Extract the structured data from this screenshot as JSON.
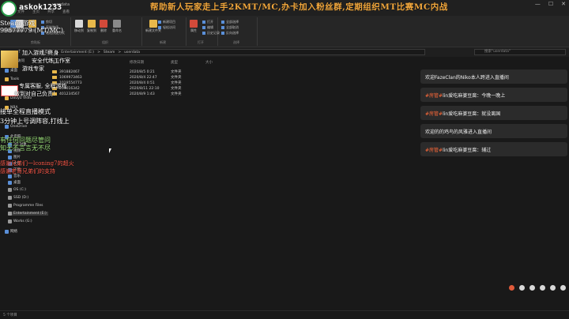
{
  "window": {
    "title": "userdata",
    "tabs": [
      "文件",
      "主页",
      "共享",
      "查看"
    ],
    "minimize_glyph": "—",
    "maximize_glyph": "☐",
    "close_glyph": "✕"
  },
  "ribbon": {
    "groups": [
      {
        "label": "剪贴板",
        "buttons": [
          "固定到快速访问",
          "复制",
          "粘贴"
        ],
        "small": [
          "剪切",
          "复制路径",
          "粘贴快捷方式"
        ]
      },
      {
        "label": "组织",
        "buttons": [
          "移动到",
          "复制到",
          "删除",
          "重命名"
        ]
      },
      {
        "label": "新建",
        "buttons": [
          "新建文件夹"
        ],
        "small": [
          "新建项目",
          "轻松访问"
        ]
      },
      {
        "label": "打开",
        "buttons": [
          "属性"
        ],
        "small": [
          "打开",
          "编辑",
          "历史记录"
        ]
      },
      {
        "label": "选择",
        "small": [
          "全部选择",
          "全部取消",
          "反向选择"
        ]
      }
    ]
  },
  "address": {
    "nav": [
      "←",
      "→",
      "↑"
    ],
    "crumbs": [
      "此电脑",
      "Entertainment (E:)",
      "Steam",
      "userdata"
    ],
    "separator": ">",
    "search_placeholder": "搜索\"userdata\""
  },
  "sidebar": {
    "items": [
      {
        "label": "快速访问",
        "color": "#5a8fd8"
      },
      {
        "label": "桌面",
        "color": "#5a8fd8"
      },
      {
        "label": "Tools",
        "color": "#e8b84a"
      },
      {
        "label": "下载",
        "color": "#5a8fd8"
      },
      {
        "label": "Douyu Vidio",
        "color": "#e8b84a"
      },
      {
        "label": "NBA",
        "color": "#e8b84a"
      },
      {
        "label": "OneDrive",
        "color": "#5a8fd8"
      },
      {
        "label": "此电脑",
        "color": "#5a8fd8"
      },
      {
        "label": "3D 对象",
        "color": "#5a8fd8"
      },
      {
        "label": "视频",
        "color": "#5a8fd8"
      },
      {
        "label": "图片",
        "color": "#5a8fd8"
      },
      {
        "label": "文档",
        "color": "#5a8fd8"
      },
      {
        "label": "下载",
        "color": "#5a8fd8"
      },
      {
        "label": "音乐",
        "color": "#5a8fd8"
      },
      {
        "label": "桌面",
        "color": "#5a8fd8"
      },
      {
        "label": "OS (C:)",
        "color": "#999999"
      },
      {
        "label": "SSD (D:)",
        "color": "#999999"
      },
      {
        "label": "Programme Files",
        "color": "#999999"
      },
      {
        "label": "Entertainment (E:)",
        "color": "#999999",
        "active": true
      },
      {
        "label": "Works (G:)",
        "color": "#999999"
      },
      {
        "label": "网络",
        "color": "#5a8fd8"
      }
    ]
  },
  "list": {
    "headers": [
      "名称",
      "修改日期",
      "类型",
      "大小"
    ],
    "rows": [
      {
        "name": "391882467",
        "date": "2020/8/5 0:21",
        "type": "文件夹"
      },
      {
        "name": "1069973463",
        "date": "2020/8/4 22:47",
        "type": "文件夹"
      },
      {
        "name": "1019554773",
        "date": "2020/8/4 0:51",
        "type": "文件夹"
      },
      {
        "name": "201016342",
        "date": "2020/8/11 22:10",
        "type": "文件夹"
      },
      {
        "name": "401234567",
        "date": "2020/8/9 1:43",
        "type": "文件夹"
      }
    ]
  },
  "status": {
    "text": "5 个项目"
  },
  "overlay": {
    "banner": "帮助新人玩家走上手2KMT/MC,办卡加入粉丝群,定期组织MT比赛MC内战",
    "handle": "askok1233",
    "lines": [
      {
        "text": "Steam 游戏",
        "cls": "ov-white",
        "size": 8
      },
      {
        "text": "99877779 (MT/MC)",
        "cls": "ov-white",
        "size": 8
      },
      {
        "text": "加入游戏, 终身",
        "cls": "ov-white",
        "size": 7
      },
      {
        "text": "安全代练工作室",
        "cls": "ov-white",
        "size": 7
      },
      {
        "text": "游戏专家",
        "cls": "ov-white",
        "size": 7
      },
      {
        "text": "专属客服, 全程游戏",
        "cls": "ov-white",
        "size": 7
      },
      {
        "text": "做到对自己负责!",
        "cls": "ov-white",
        "size": 7
      },
      {
        "text": "接单全程直播模式",
        "cls": "ov-white",
        "size": 8
      },
      {
        "text": "3分钟上号调阵容,打线上",
        "cls": "ov-white",
        "size": 8
      },
      {
        "text": "有任何问题尽管问",
        "cls": "ov-green",
        "size": 8
      },
      {
        "text": "知无不言言无不尽",
        "cls": "ov-green",
        "size": 8
      },
      {
        "text": "感谢兄弟们一lconing7的超火",
        "cls": "ov-red",
        "size": 7
      },
      {
        "text": "感谢老哥兄弟们的支持",
        "cls": "ov-red",
        "size": 7
      }
    ]
  },
  "chat": {
    "messages": [
      {
        "tag": "",
        "text": "欢迎FazeClan的Niko本人跨进入直播间"
      },
      {
        "tag": "#房管#",
        "text": "lin爱吃麻婆豆腐：今晚一晚上"
      },
      {
        "tag": "#房管#",
        "text": "lin爱吃麻婆豆腐：就没离国"
      },
      {
        "tag": "",
        "text": "欢迎的的鸡鸟的风雅进入直播间"
      },
      {
        "tag": "#房管#",
        "text": "lin爱吃麻婆豆腐：辅过"
      }
    ]
  },
  "colors": {
    "folder": "#e8b84a",
    "accent": "#5a8fd8",
    "banner": "#f0a63c",
    "chat_tag": "#ff6a3a"
  }
}
